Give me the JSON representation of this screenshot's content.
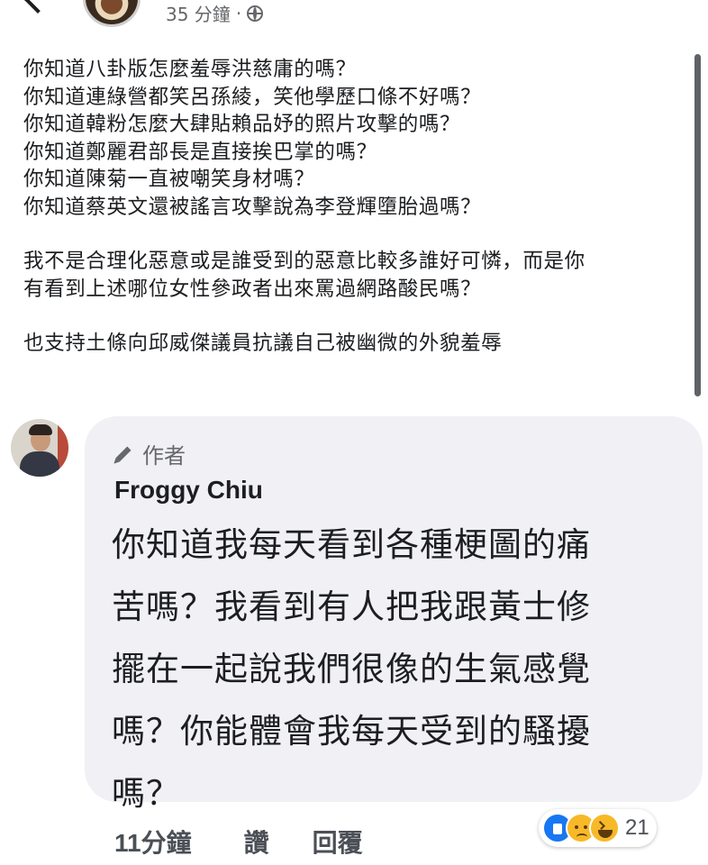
{
  "post": {
    "timestamp": "35 分鐘",
    "separator": "·",
    "privacy_icon": "globe-icon",
    "lines": [
      "你知道八卦版怎麼羞辱洪慈庸的嗎？",
      "你知道連綠營都笑呂孫綾，笑他學歷口條不好嗎？",
      "你知道韓粉怎麼大肆貼賴品妤的照片攻擊的嗎？",
      "你知道鄭麗君部長是直接挨巴掌的嗎？",
      "你知道陳菊一直被嘲笑身材嗎？",
      "你知道蔡英文還被謠言攻擊說為李登輝墮胎過嗎？"
    ],
    "paragraph2": [
      "我不是合理化惡意或是誰受到的惡意比較多誰好可憐，而是你",
      "有看到上述哪位女性參政者出來罵過網路酸民嗎？"
    ],
    "paragraph3": "也支持土條向邱威傑議員抗議自己被幽微的外貌羞辱"
  },
  "comment": {
    "author_badge": "作者",
    "author_name": "Froggy Chiu",
    "lines": [
      "你知道我每天看到各種梗圖的痛",
      "苦嗎？我看到有人把我跟黃士修",
      "擺在一起說我們很像的生氣感覺",
      "嗎？你能體會我每天受到的騷擾",
      "嗎？"
    ],
    "time": "11分鐘",
    "like_label": "讚",
    "reply_label": "回覆",
    "reactions": {
      "icons": [
        "like-icon",
        "sad-icon",
        "haha-icon"
      ],
      "count": "21"
    }
  }
}
